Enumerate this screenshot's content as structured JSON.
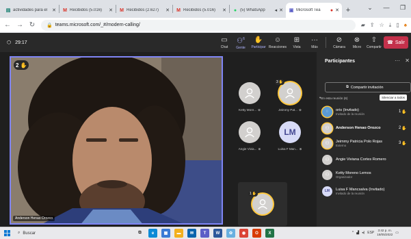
{
  "browser": {
    "tabs": [
      {
        "label": "actividades para el",
        "icon": "ms-forms-icon",
        "active": false
      },
      {
        "label": "Recibidos (5.016)",
        "icon": "gmail-icon",
        "active": false
      },
      {
        "label": "Recibidos (2.627)",
        "icon": "gmail-icon",
        "active": false
      },
      {
        "label": "Recibidos (5.016)",
        "icon": "gmail-icon",
        "active": false
      },
      {
        "label": "(5) WhatsApp",
        "icon": "whatsapp-icon",
        "active": false
      },
      {
        "label": "Microsoft Tea",
        "icon": "teams-icon",
        "active": true
      }
    ],
    "url": "teams.microsoft.com/_#/modern-calling/"
  },
  "meeting": {
    "timer": "29:17",
    "toolbar": [
      {
        "label": "Chat",
        "icon": "chat-icon"
      },
      {
        "label": "Gente",
        "icon": "people-icon",
        "count": "6"
      },
      {
        "label": "Participar",
        "icon": "raise-hand-icon"
      },
      {
        "label": "Reacciones",
        "icon": "reactions-icon"
      },
      {
        "label": "Vista",
        "icon": "view-icon"
      },
      {
        "label": "Más",
        "icon": "more-icon"
      },
      {
        "label": "Cámara",
        "icon": "camera-off-icon"
      },
      {
        "label": "Micro",
        "icon": "mic-off-icon"
      },
      {
        "label": "Compartir",
        "icon": "share-icon"
      }
    ],
    "leave_label": "Salir",
    "main_video": {
      "name": "Anderson Henao Orozco",
      "hand_number": "2"
    },
    "tiles": [
      {
        "name": "Ketty More...",
        "initials": "",
        "hand_number": ""
      },
      {
        "name": "Jeimmy Pat...",
        "initials": "",
        "hand_number": "3"
      },
      {
        "name": "Angie Vivia...",
        "initials": "",
        "hand_number": ""
      },
      {
        "name": "Luisa F Man...",
        "initials": "LM",
        "hand_number": ""
      }
    ],
    "self_view": {
      "hand_number": "1"
    }
  },
  "panel": {
    "title": "Participantes",
    "invite_label": "Compartir invitación",
    "section_label": "En esta reunión (6)",
    "mute_all_label": "Silenciar a todos",
    "participants": [
      {
        "name": "oris (Invitado)",
        "role": "Invitado de la reunión",
        "hand": "1",
        "initials": ""
      },
      {
        "name": "Anderson Henao Orozco",
        "role": "",
        "hand": "2",
        "initials": ""
      },
      {
        "name": "Jeimmy Patricia Polo Rojas",
        "role": "Externo",
        "hand": "3",
        "initials": ""
      },
      {
        "name": "Angie Viviana Cortes Romero",
        "role": "",
        "hand": "",
        "initials": ""
      },
      {
        "name": "Ketty Moreno Lemos",
        "role": "Organizador",
        "hand": "",
        "initials": ""
      },
      {
        "name": "Luisa F Mancsalva (Invitado)",
        "role": "Invitado de la reunión",
        "hand": "",
        "initials": "LM"
      }
    ]
  },
  "taskbar": {
    "search_placeholder": "Buscar",
    "lang": "ESP",
    "time": "3:42 p. m.",
    "date": "18/05/2022"
  },
  "colors": {
    "accent": "#7f85f5",
    "hand": "#ffc83d",
    "leave": "#c4314b",
    "teams_bg": "#292929"
  }
}
